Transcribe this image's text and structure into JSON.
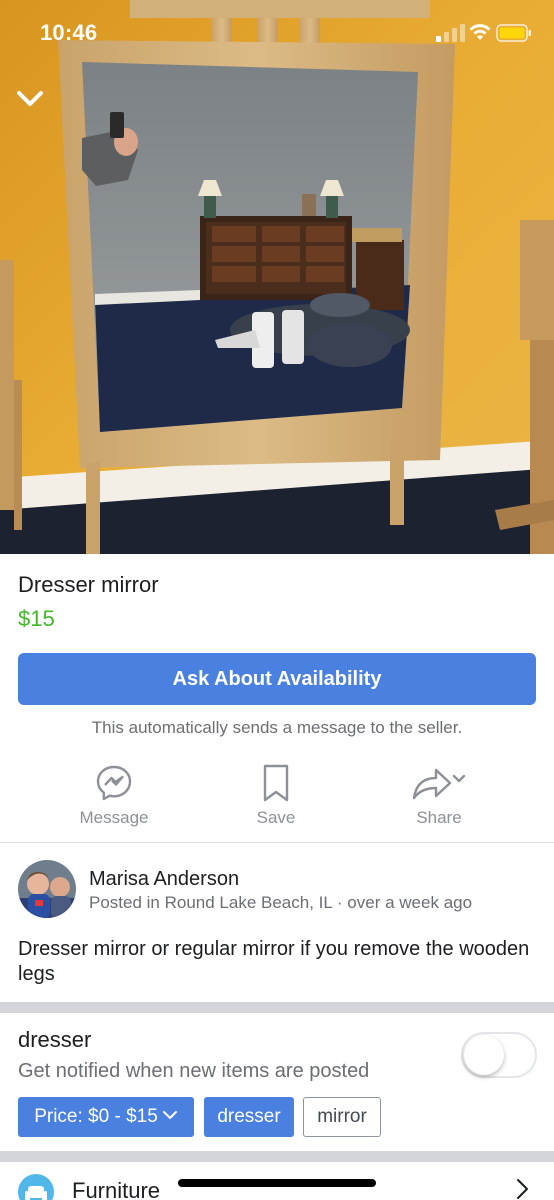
{
  "status_bar": {
    "time": "10:46",
    "icons": [
      "cellular-signal-icon",
      "wifi-icon",
      "battery-icon"
    ]
  },
  "header": {
    "collapse_icon": "chevron-down-icon"
  },
  "listing": {
    "title": "Dresser mirror",
    "price": "$15",
    "price_color": "#42b72a",
    "ask_button_label": "Ask About Availability",
    "auto_message_note": "This automatically sends a message to the seller."
  },
  "actions": [
    {
      "label": "Message",
      "icon": "messenger-icon"
    },
    {
      "label": "Save",
      "icon": "bookmark-icon"
    },
    {
      "label": "Share",
      "icon": "share-arrow-icon"
    }
  ],
  "seller": {
    "name": "Marisa Anderson",
    "meta": "Posted in Round Lake Beach, IL · over a week ago"
  },
  "description": "Dresser mirror or regular mirror if you remove the wooden legs",
  "search_alert": {
    "query": "dresser",
    "subtitle": "Get notified when new items are posted",
    "toggle_on": false
  },
  "filters": [
    {
      "label": "Price: $0 - $15",
      "active": true
    },
    {
      "label": "dresser",
      "active": true
    },
    {
      "label": "mirror",
      "active": false
    }
  ],
  "category": {
    "label": "Furniture",
    "icon": "armchair-icon"
  },
  "colors": {
    "primary_button": "#4a80e0",
    "secondary_text": "#6b6e73",
    "divider": "#d3d5da"
  }
}
